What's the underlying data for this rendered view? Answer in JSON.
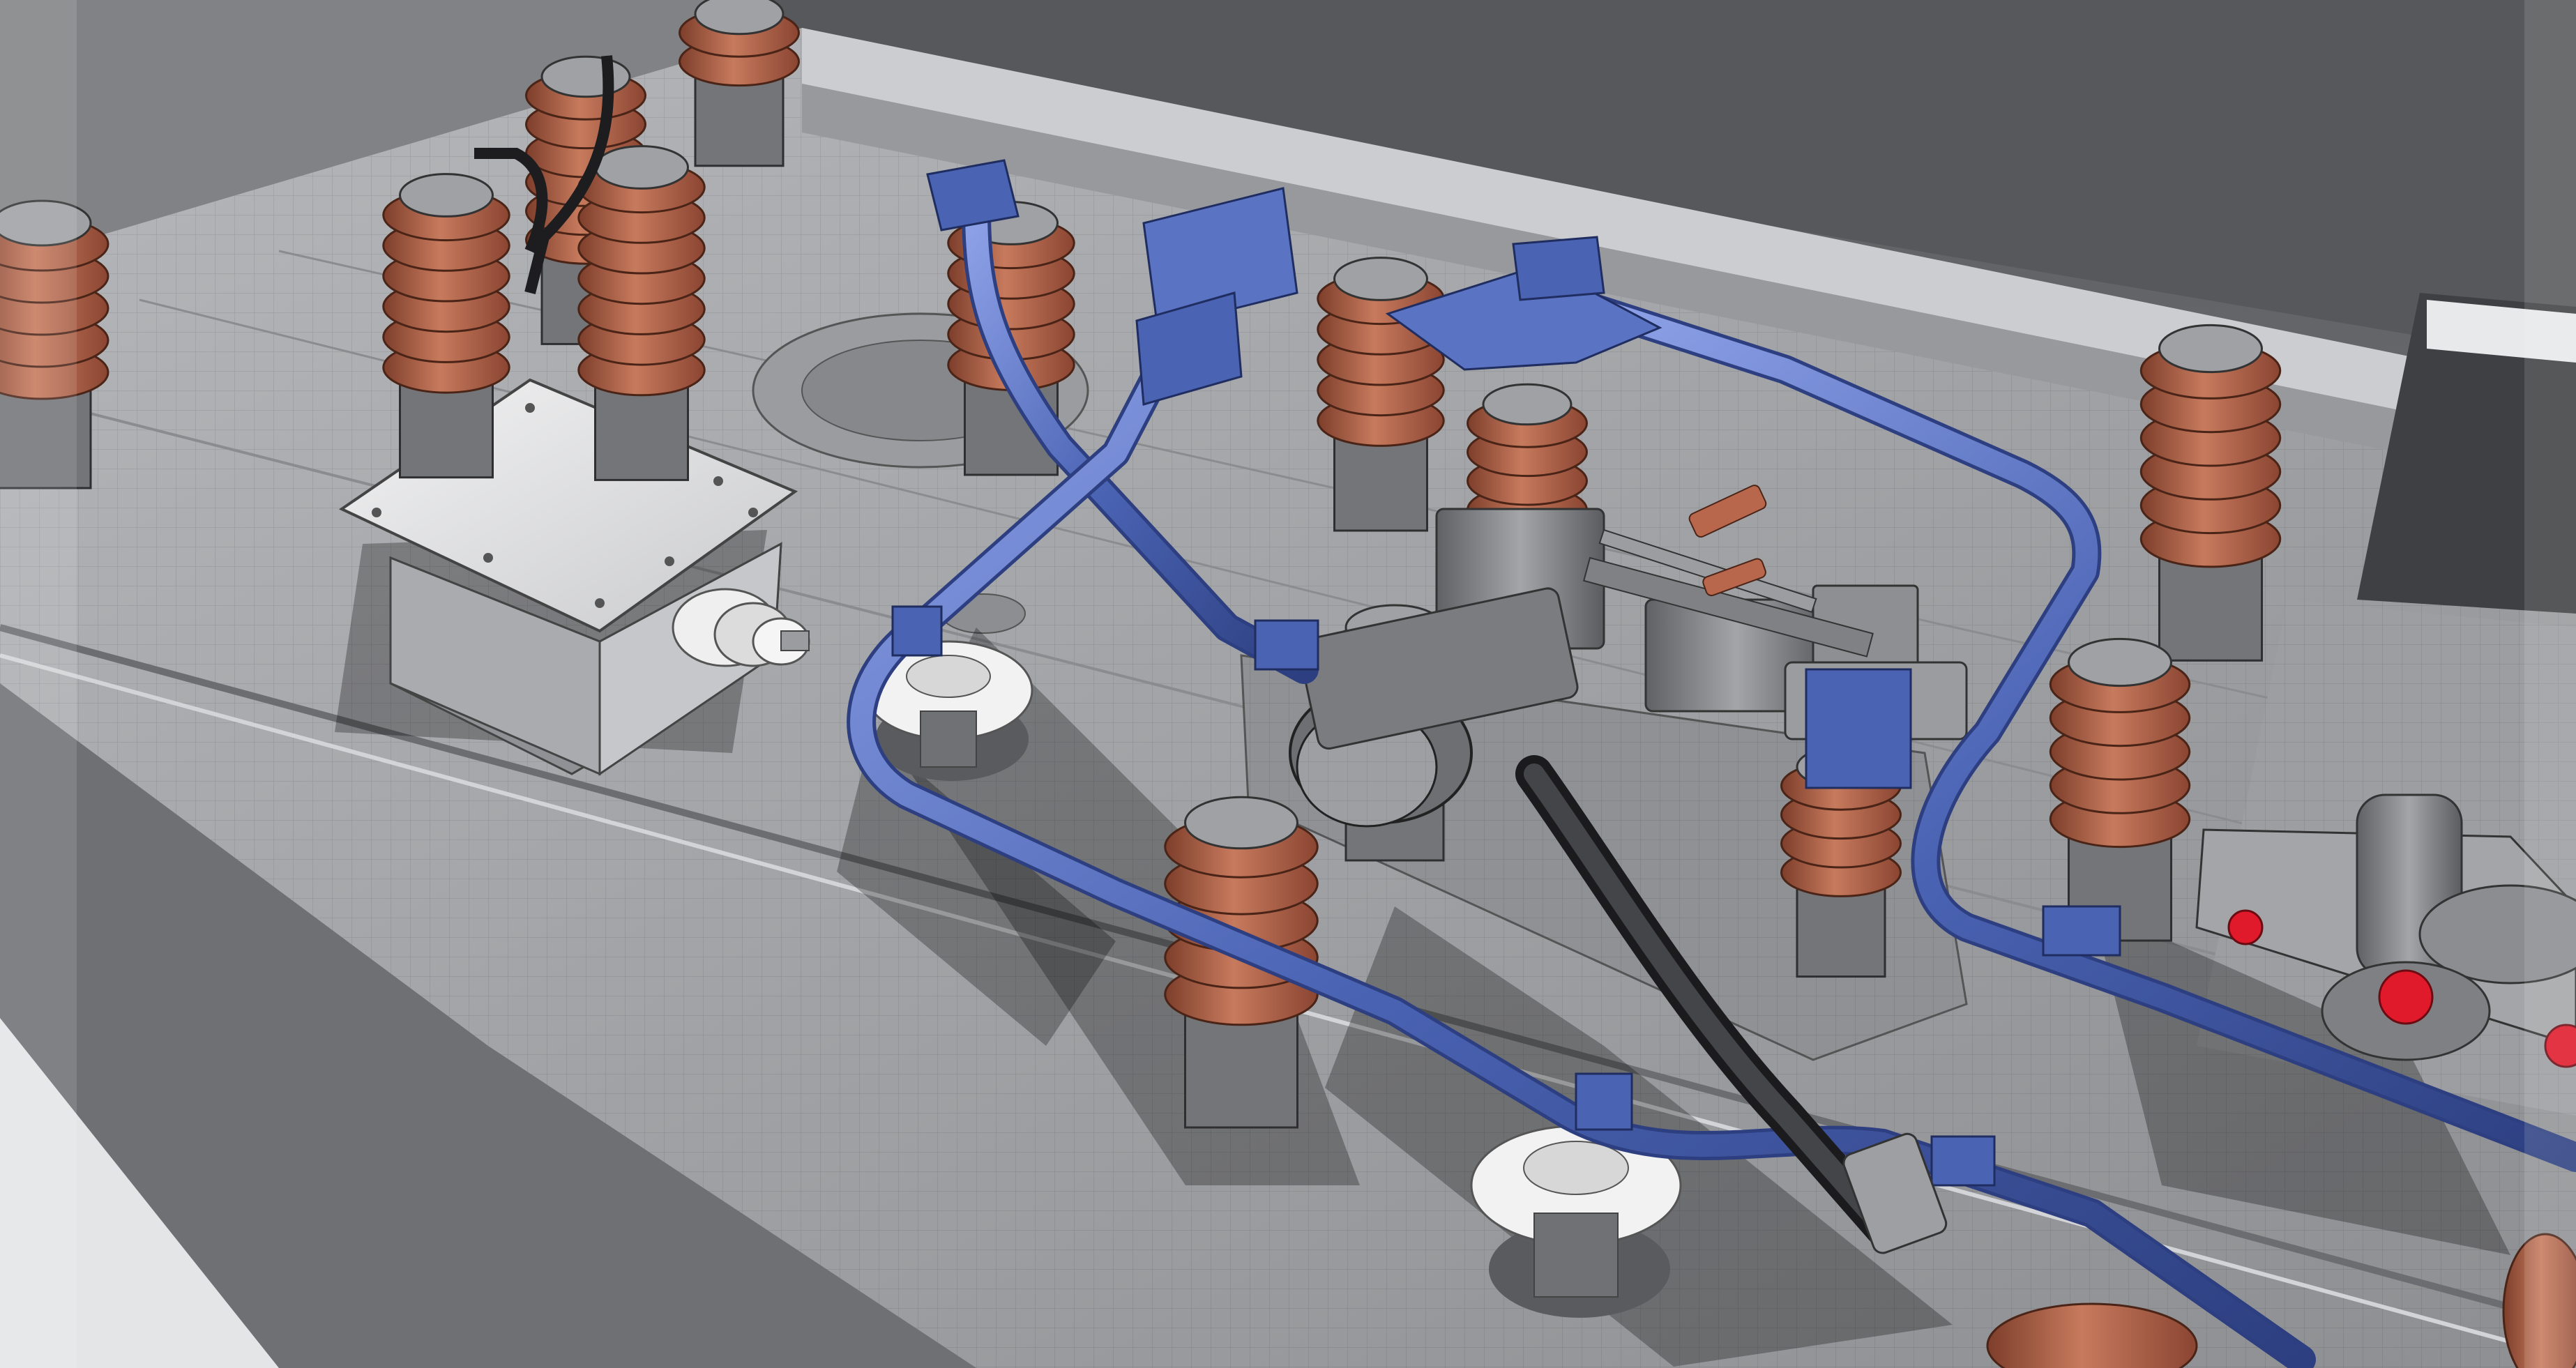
{
  "scene": {
    "colors": {
      "background_wall": "#6f7174",
      "deck": "#a8aaad",
      "deck_dark": "#7e8083",
      "deck_light": "#c7c9cc",
      "insulator_terracotta": "#b8674c",
      "insulator_dark": "#7d3e2b",
      "busbar_blue": "#4a63b3",
      "busbar_highlight": "#8ea2e8",
      "porcelain_white": "#e9e9ea",
      "metal_grey": "#8b8d90",
      "cable_black": "#2c2c2e",
      "cap_red": "#e0192b"
    },
    "objects": [
      "insulator-stack",
      "terminal-box",
      "busbar-conductor",
      "disconnect-switch",
      "flexible-cable",
      "porcelain-bushing",
      "operating-mechanism"
    ]
  }
}
